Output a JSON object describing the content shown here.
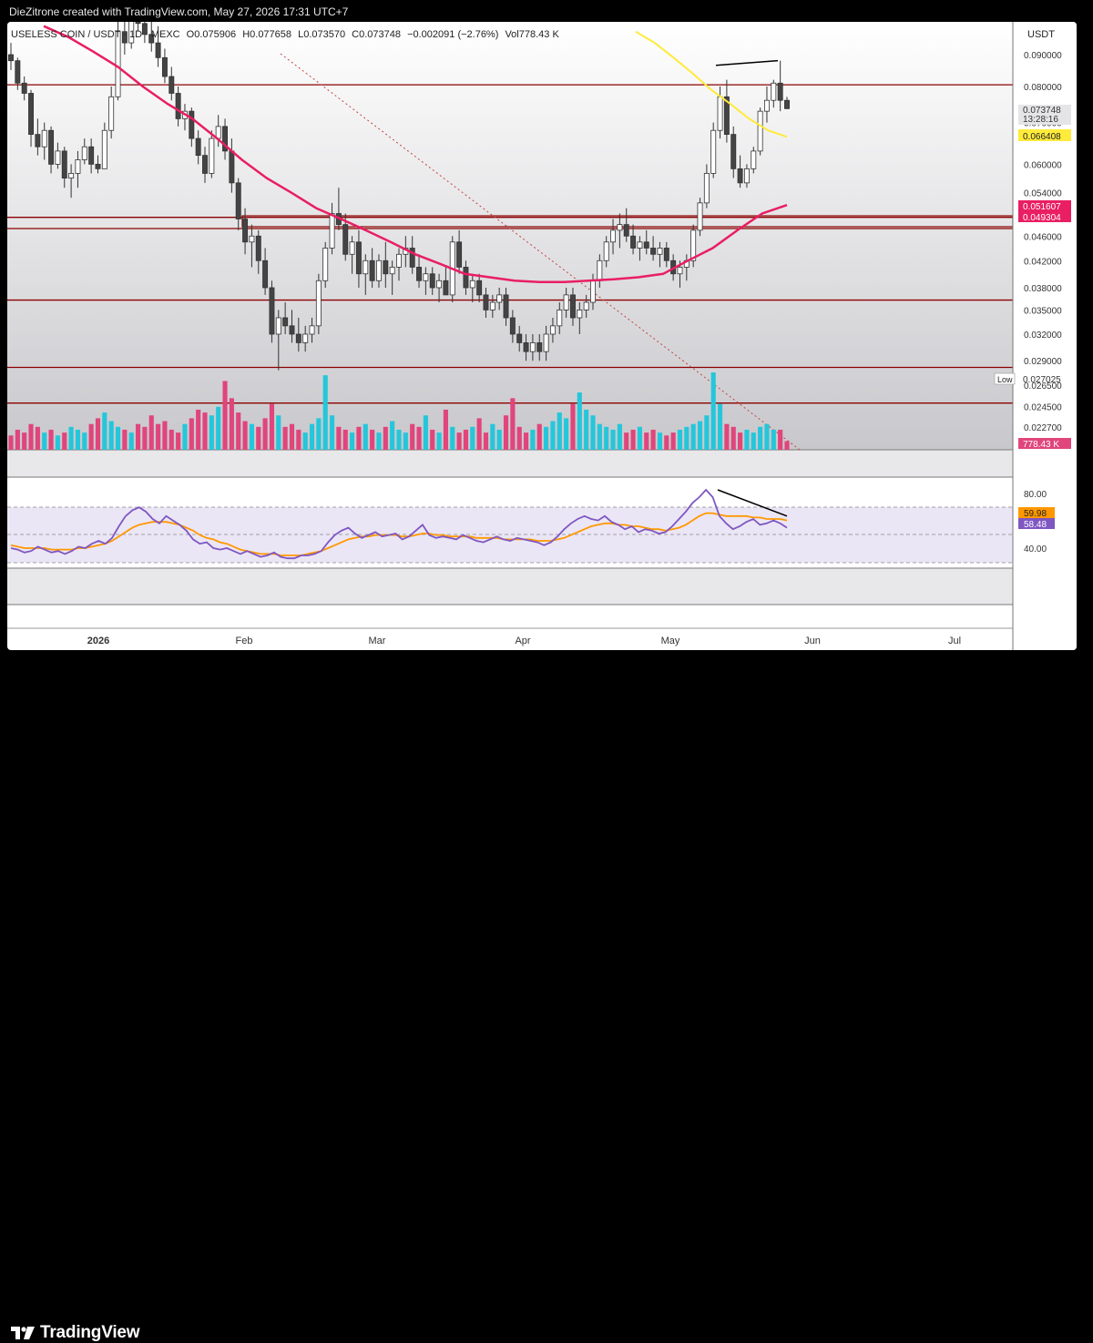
{
  "header": {
    "credit": "DieZitrone created with TradingView.com, May 27, 2026 17:31 UTC+7"
  },
  "footer": {
    "brand": "TradingView"
  },
  "legend": {
    "symbol": "USELESS COIN / USDT · 1D · MEXC",
    "o_label": "O",
    "o_value": "0.075906",
    "h_label": "H",
    "h_value": "0.077658",
    "l_label": "L",
    "l_value": "0.073570",
    "c_label": "C",
    "c_value": "0.073748",
    "change": "−0.002091 (−2.76%)",
    "vol_label": "Vol",
    "vol_value": "778.43 K"
  },
  "currency": "USDT",
  "price_axis": [
    "0.090000",
    "0.080000",
    "0.070000",
    "0.060000",
    "0.054000",
    "0.046000",
    "0.042000",
    "0.038000",
    "0.035000",
    "0.032000",
    "0.029000",
    "0.026500",
    "0.024500",
    "0.022700"
  ],
  "tags": {
    "last_price": "0.073748",
    "countdown": "13:28:16",
    "yellow_ma": "0.066408",
    "pink_ma": "0.051607",
    "pink_level": "0.049304",
    "low_label": "Low",
    "low_value": "0.027025",
    "volume": "778.43 K"
  },
  "rsi": {
    "axis": [
      "80.00",
      "40.00"
    ],
    "orange_value": "59.98",
    "purple_value": "58.48"
  },
  "time_axis": [
    "2026",
    "Feb",
    "Mar",
    "Apr",
    "May",
    "Jun",
    "Jul"
  ],
  "colors": {
    "up": "#ffffff",
    "down": "#444444",
    "volume_up": "#26c6da",
    "volume_down": "#e0457b",
    "ma_long": "#e91e63",
    "ma_short": "#ffeb3b",
    "level_line": "#8b0000",
    "rsi": "#7e57c2",
    "rsi_ma": "#ff9800"
  },
  "chart_data": {
    "type": "candlestick",
    "scale": "log",
    "x_labels": [
      "2026",
      "Feb",
      "Mar",
      "Apr",
      "May",
      "Jun",
      "Jul"
    ],
    "candles": [
      [
        0.09,
        0.094,
        0.085,
        0.088
      ],
      [
        0.088,
        0.089,
        0.079,
        0.081
      ],
      [
        0.081,
        0.083,
        0.076,
        0.078
      ],
      [
        0.078,
        0.079,
        0.064,
        0.067
      ],
      [
        0.067,
        0.071,
        0.062,
        0.064
      ],
      [
        0.064,
        0.07,
        0.061,
        0.068
      ],
      [
        0.068,
        0.069,
        0.058,
        0.06
      ],
      [
        0.06,
        0.065,
        0.059,
        0.063
      ],
      [
        0.063,
        0.064,
        0.055,
        0.057
      ],
      [
        0.057,
        0.06,
        0.053,
        0.058
      ],
      [
        0.058,
        0.063,
        0.055,
        0.061
      ],
      [
        0.061,
        0.066,
        0.06,
        0.064
      ],
      [
        0.064,
        0.066,
        0.058,
        0.06
      ],
      [
        0.06,
        0.062,
        0.058,
        0.059
      ],
      [
        0.059,
        0.07,
        0.059,
        0.068
      ],
      [
        0.068,
        0.08,
        0.066,
        0.077
      ],
      [
        0.077,
        0.105,
        0.076,
        0.098
      ],
      [
        0.098,
        0.104,
        0.09,
        0.094
      ],
      [
        0.094,
        0.112,
        0.092,
        0.108
      ],
      [
        0.108,
        0.112,
        0.098,
        0.101
      ],
      [
        0.101,
        0.107,
        0.094,
        0.097
      ],
      [
        0.097,
        0.104,
        0.091,
        0.094
      ],
      [
        0.094,
        0.1,
        0.086,
        0.089
      ],
      [
        0.089,
        0.092,
        0.081,
        0.083
      ],
      [
        0.083,
        0.086,
        0.076,
        0.078
      ],
      [
        0.078,
        0.08,
        0.069,
        0.071
      ],
      [
        0.071,
        0.075,
        0.068,
        0.073
      ],
      [
        0.073,
        0.074,
        0.064,
        0.066
      ],
      [
        0.066,
        0.068,
        0.06,
        0.062
      ],
      [
        0.062,
        0.064,
        0.056,
        0.058
      ],
      [
        0.058,
        0.068,
        0.057,
        0.066
      ],
      [
        0.066,
        0.072,
        0.064,
        0.069
      ],
      [
        0.069,
        0.071,
        0.061,
        0.063
      ],
      [
        0.063,
        0.066,
        0.054,
        0.056
      ],
      [
        0.056,
        0.057,
        0.047,
        0.049
      ],
      [
        0.049,
        0.051,
        0.043,
        0.045
      ],
      [
        0.045,
        0.048,
        0.041,
        0.046
      ],
      [
        0.046,
        0.047,
        0.04,
        0.042
      ],
      [
        0.042,
        0.044,
        0.037,
        0.038
      ],
      [
        0.038,
        0.039,
        0.031,
        0.032
      ],
      [
        0.032,
        0.035,
        0.028,
        0.034
      ],
      [
        0.034,
        0.036,
        0.032,
        0.033
      ],
      [
        0.033,
        0.035,
        0.031,
        0.032
      ],
      [
        0.032,
        0.034,
        0.03,
        0.031
      ],
      [
        0.031,
        0.033,
        0.03,
        0.032
      ],
      [
        0.032,
        0.034,
        0.031,
        0.033
      ],
      [
        0.033,
        0.04,
        0.032,
        0.039
      ],
      [
        0.039,
        0.045,
        0.038,
        0.044
      ],
      [
        0.044,
        0.052,
        0.043,
        0.05
      ],
      [
        0.05,
        0.055,
        0.047,
        0.048
      ],
      [
        0.048,
        0.05,
        0.042,
        0.043
      ],
      [
        0.043,
        0.046,
        0.04,
        0.045
      ],
      [
        0.045,
        0.047,
        0.038,
        0.04
      ],
      [
        0.04,
        0.043,
        0.037,
        0.042
      ],
      [
        0.042,
        0.044,
        0.038,
        0.039
      ],
      [
        0.039,
        0.043,
        0.038,
        0.042
      ],
      [
        0.042,
        0.045,
        0.038,
        0.04
      ],
      [
        0.04,
        0.042,
        0.037,
        0.041
      ],
      [
        0.041,
        0.044,
        0.039,
        0.043
      ],
      [
        0.043,
        0.046,
        0.041,
        0.044
      ],
      [
        0.044,
        0.046,
        0.04,
        0.041
      ],
      [
        0.041,
        0.043,
        0.038,
        0.039
      ],
      [
        0.039,
        0.041,
        0.037,
        0.04
      ],
      [
        0.04,
        0.041,
        0.037,
        0.038
      ],
      [
        0.038,
        0.04,
        0.036,
        0.039
      ],
      [
        0.039,
        0.041,
        0.037,
        0.037
      ],
      [
        0.037,
        0.046,
        0.036,
        0.045
      ],
      [
        0.045,
        0.047,
        0.04,
        0.041
      ],
      [
        0.041,
        0.042,
        0.037,
        0.038
      ],
      [
        0.038,
        0.04,
        0.036,
        0.039
      ],
      [
        0.039,
        0.04,
        0.036,
        0.037
      ],
      [
        0.037,
        0.038,
        0.034,
        0.035
      ],
      [
        0.035,
        0.037,
        0.034,
        0.036
      ],
      [
        0.036,
        0.038,
        0.035,
        0.037
      ],
      [
        0.037,
        0.038,
        0.033,
        0.034
      ],
      [
        0.034,
        0.035,
        0.031,
        0.032
      ],
      [
        0.032,
        0.033,
        0.03,
        0.031
      ],
      [
        0.031,
        0.032,
        0.029,
        0.03
      ],
      [
        0.03,
        0.032,
        0.029,
        0.031
      ],
      [
        0.031,
        0.032,
        0.029,
        0.03
      ],
      [
        0.03,
        0.033,
        0.029,
        0.032
      ],
      [
        0.032,
        0.034,
        0.031,
        0.033
      ],
      [
        0.033,
        0.036,
        0.032,
        0.035
      ],
      [
        0.035,
        0.038,
        0.034,
        0.037
      ],
      [
        0.037,
        0.038,
        0.033,
        0.034
      ],
      [
        0.034,
        0.036,
        0.032,
        0.035
      ],
      [
        0.035,
        0.037,
        0.034,
        0.036
      ],
      [
        0.036,
        0.04,
        0.035,
        0.039
      ],
      [
        0.039,
        0.043,
        0.038,
        0.042
      ],
      [
        0.042,
        0.046,
        0.041,
        0.045
      ],
      [
        0.045,
        0.049,
        0.043,
        0.047
      ],
      [
        0.047,
        0.05,
        0.044,
        0.048
      ],
      [
        0.048,
        0.051,
        0.045,
        0.046
      ],
      [
        0.046,
        0.048,
        0.043,
        0.044
      ],
      [
        0.044,
        0.046,
        0.042,
        0.045
      ],
      [
        0.045,
        0.047,
        0.043,
        0.044
      ],
      [
        0.044,
        0.046,
        0.042,
        0.043
      ],
      [
        0.043,
        0.045,
        0.041,
        0.044
      ],
      [
        0.044,
        0.045,
        0.041,
        0.042
      ],
      [
        0.042,
        0.043,
        0.039,
        0.04
      ],
      [
        0.04,
        0.042,
        0.038,
        0.041
      ],
      [
        0.041,
        0.043,
        0.039,
        0.042
      ],
      [
        0.042,
        0.048,
        0.041,
        0.047
      ],
      [
        0.047,
        0.053,
        0.046,
        0.052
      ],
      [
        0.052,
        0.06,
        0.051,
        0.058
      ],
      [
        0.058,
        0.07,
        0.057,
        0.068
      ],
      [
        0.068,
        0.08,
        0.066,
        0.077
      ],
      [
        0.077,
        0.082,
        0.065,
        0.067
      ],
      [
        0.067,
        0.069,
        0.057,
        0.059
      ],
      [
        0.059,
        0.062,
        0.055,
        0.056
      ],
      [
        0.056,
        0.06,
        0.055,
        0.059
      ],
      [
        0.059,
        0.064,
        0.058,
        0.063
      ],
      [
        0.063,
        0.074,
        0.062,
        0.073
      ],
      [
        0.073,
        0.08,
        0.07,
        0.076
      ],
      [
        0.076,
        0.082,
        0.074,
        0.081
      ],
      [
        0.081,
        0.088,
        0.073,
        0.076
      ],
      [
        0.076,
        0.077,
        0.0736,
        0.0737
      ]
    ],
    "volume": [
      0.5,
      0.7,
      0.6,
      0.9,
      0.8,
      0.6,
      0.7,
      0.5,
      0.6,
      0.8,
      0.7,
      0.6,
      0.9,
      1.1,
      1.3,
      1.0,
      0.8,
      0.7,
      0.6,
      0.9,
      0.8,
      1.2,
      0.9,
      1.0,
      0.7,
      0.6,
      0.9,
      1.1,
      1.4,
      1.3,
      1.2,
      1.5,
      2.4,
      1.8,
      1.3,
      1.0,
      0.9,
      0.8,
      1.1,
      1.6,
      1.2,
      0.8,
      0.9,
      0.7,
      0.6,
      0.9,
      1.1,
      2.6,
      1.2,
      0.8,
      0.7,
      0.6,
      0.8,
      0.9,
      0.7,
      0.6,
      0.8,
      1.0,
      0.7,
      0.6,
      0.9,
      0.8,
      1.2,
      0.7,
      0.6,
      1.4,
      0.8,
      0.6,
      0.7,
      0.8,
      1.1,
      0.6,
      0.9,
      0.7,
      1.2,
      1.8,
      0.8,
      0.6,
      0.7,
      0.9,
      0.8,
      1.0,
      1.3,
      1.1,
      1.6,
      2.0,
      1.4,
      1.2,
      0.9,
      0.8,
      0.7,
      0.9,
      0.6,
      0.7,
      0.8,
      0.6,
      0.7,
      0.6,
      0.5,
      0.6,
      0.7,
      0.8,
      0.9,
      1.0,
      1.2,
      2.7,
      1.6,
      0.9,
      0.8,
      0.6,
      0.7,
      0.6,
      0.8,
      0.9,
      0.7,
      0.7,
      0.3
    ],
    "ma_long": [
      0.1,
      0.096,
      0.091,
      0.086,
      0.08,
      0.075,
      0.071,
      0.066,
      0.061,
      0.057,
      0.054,
      0.051,
      0.049,
      0.047,
      0.045,
      0.043,
      0.0415,
      0.04,
      0.0395,
      0.039,
      0.0388,
      0.0388,
      0.039,
      0.0392,
      0.0395,
      0.04,
      0.042,
      0.044,
      0.047,
      0.05,
      0.0516
    ],
    "ma_short": [
      0.098,
      0.094,
      0.089,
      0.084,
      0.079,
      0.075,
      0.071,
      0.068,
      0.0664
    ],
    "levels": [
      0.0805,
      0.0493,
      0.0473,
      0.0363,
      0.0283,
      0.0248
    ],
    "rsi": [
      40,
      39,
      37,
      38,
      41,
      39,
      37,
      38,
      36,
      38,
      41,
      40,
      43,
      45,
      43,
      47,
      55,
      62,
      66,
      68,
      65,
      60,
      57,
      62,
      59,
      56,
      52,
      46,
      43,
      44,
      40,
      39,
      40,
      38,
      36,
      38,
      36,
      34,
      35,
      37,
      34,
      33,
      33,
      35,
      35,
      36,
      38,
      44,
      49,
      52,
      54,
      50,
      47,
      49,
      51,
      48,
      49,
      50,
      46,
      48,
      52,
      56,
      49,
      47,
      48,
      47,
      46,
      49,
      47,
      45,
      44,
      46,
      48,
      46,
      45,
      47,
      46,
      45,
      44,
      42,
      44,
      48,
      53,
      57,
      60,
      62,
      60,
      59,
      62,
      58,
      56,
      53,
      55,
      51,
      53,
      52,
      50,
      51,
      55,
      60,
      65,
      71,
      75,
      80,
      75,
      62,
      57,
      53,
      55,
      58,
      60,
      56,
      57,
      59,
      57,
      54
    ],
    "rsi_ma": [
      42,
      41,
      40,
      40,
      40,
      40,
      39,
      39,
      39,
      39,
      40,
      40,
      41,
      42,
      43,
      45,
      48,
      51,
      54,
      56,
      57,
      58,
      58,
      58,
      57,
      56,
      54,
      52,
      49,
      47,
      46,
      44,
      43,
      41,
      39,
      38,
      37,
      36,
      36,
      36,
      35,
      35,
      35,
      35,
      36,
      37,
      38,
      40,
      42,
      44,
      46,
      47,
      48,
      48,
      49,
      49,
      49,
      49,
      48,
      48,
      49,
      50,
      50,
      49,
      49,
      48,
      48,
      48,
      48,
      47,
      47,
      47,
      47,
      46,
      46,
      46,
      46,
      46,
      45,
      45,
      45,
      46,
      47,
      49,
      51,
      53,
      55,
      56,
      57,
      57,
      56,
      56,
      55,
      55,
      54,
      53,
      53,
      52,
      53,
      54,
      56,
      59,
      62,
      64,
      64,
      63,
      62,
      62,
      62,
      62,
      61,
      61,
      60,
      60,
      60,
      59
    ],
    "divergence_price": [
      [
        0.0865,
        0.088
      ]
    ],
    "divergence_rsi": [
      [
        80,
        62
      ]
    ]
  }
}
